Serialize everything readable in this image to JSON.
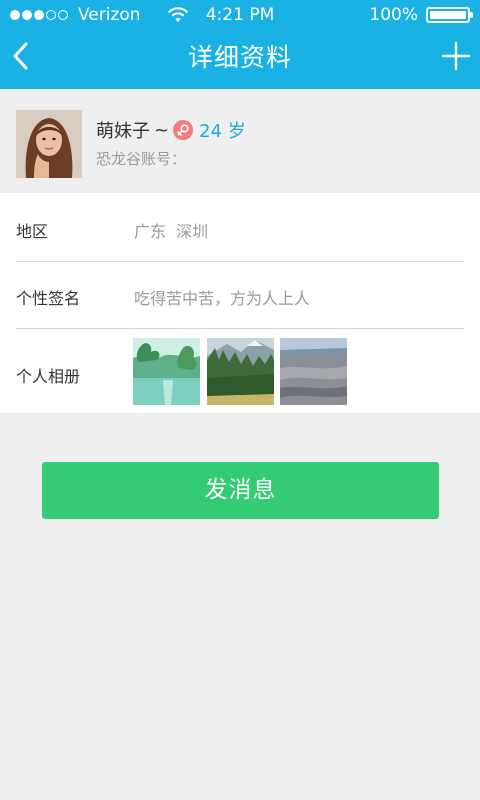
{
  "status_bar": {
    "carrier": "Verizon",
    "time": "4:21 PM",
    "battery": "100%",
    "battery_level": 1.0
  },
  "nav": {
    "title": "详细资料",
    "back_icon": "chevron-left-icon",
    "add_icon": "plus-icon"
  },
  "profile": {
    "nickname": "萌妹子",
    "tilde": "~",
    "gender_icon": "female-icon",
    "age": "24 岁",
    "account_label": "恐龙谷账号："
  },
  "details": {
    "region": {
      "label": "地区",
      "value": "广东  深圳"
    },
    "signature": {
      "label": "个性签名",
      "value": "吃得苦中苦，方为人上人"
    },
    "album": {
      "label": "个人相册",
      "photo_count": 3
    }
  },
  "actions": {
    "send_message": "发消息"
  },
  "colors": {
    "nav_blue": "#1ab2e4",
    "age_blue": "#1aa9e0",
    "send_green": "#34cb74",
    "gender_pink": "#f47b7b",
    "background": "#efefef"
  }
}
